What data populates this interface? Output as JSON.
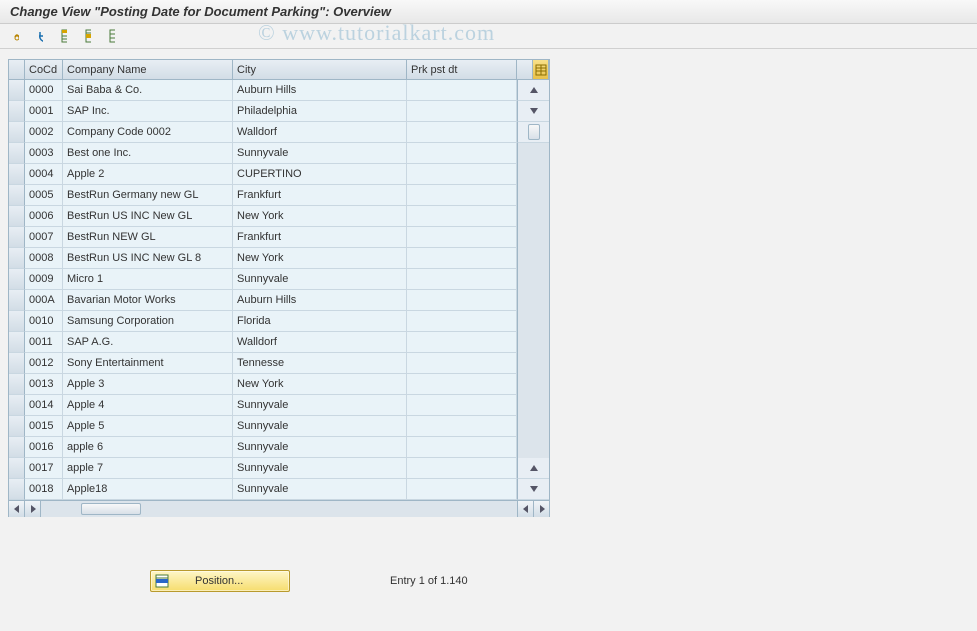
{
  "title": "Change View \"Posting Date for Document Parking\": Overview",
  "watermark": "© www.tutorialkart.com",
  "toolbar": {
    "glasses": "glasses-icon",
    "undo": "undo-icon",
    "save": "save-icon",
    "save_disk": "disk-save-icon",
    "delete": "delete-icon"
  },
  "columns": {
    "cocd": "CoCd",
    "company": "Company Name",
    "city": "City",
    "prk": "Prk pst dt"
  },
  "rows": [
    {
      "cocd": "0000",
      "company": "Sai Baba & Co.",
      "city": "Auburn Hills",
      "prk": ""
    },
    {
      "cocd": "0001",
      "company": "SAP Inc.",
      "city": "Philadelphia",
      "prk": ""
    },
    {
      "cocd": "0002",
      "company": "Company Code 0002",
      "city": "Walldorf",
      "prk": ""
    },
    {
      "cocd": "0003",
      "company": "Best one Inc.",
      "city": "Sunnyvale",
      "prk": ""
    },
    {
      "cocd": "0004",
      "company": "Apple 2",
      "city": "CUPERTINO",
      "prk": ""
    },
    {
      "cocd": "0005",
      "company": "BestRun Germany new GL",
      "city": "Frankfurt",
      "prk": ""
    },
    {
      "cocd": "0006",
      "company": "BestRun US INC New GL",
      "city": "New York",
      "prk": ""
    },
    {
      "cocd": "0007",
      "company": "BestRun NEW GL",
      "city": "Frankfurt",
      "prk": ""
    },
    {
      "cocd": "0008",
      "company": "BestRun US INC New GL 8",
      "city": "New York",
      "prk": ""
    },
    {
      "cocd": "0009",
      "company": "Micro 1",
      "city": "Sunnyvale",
      "prk": ""
    },
    {
      "cocd": "000A",
      "company": "Bavarian Motor Works",
      "city": "Auburn Hills",
      "prk": ""
    },
    {
      "cocd": "0010",
      "company": "Samsung Corporation",
      "city": "Florida",
      "prk": ""
    },
    {
      "cocd": "0011",
      "company": "SAP A.G.",
      "city": "Walldorf",
      "prk": ""
    },
    {
      "cocd": "0012",
      "company": "Sony Entertainment",
      "city": "Tennesse",
      "prk": ""
    },
    {
      "cocd": "0013",
      "company": "Apple 3",
      "city": "New York",
      "prk": ""
    },
    {
      "cocd": "0014",
      "company": "Apple 4",
      "city": "Sunnyvale",
      "prk": ""
    },
    {
      "cocd": "0015",
      "company": "Apple 5",
      "city": "Sunnyvale",
      "prk": ""
    },
    {
      "cocd": "0016",
      "company": "apple 6",
      "city": "Sunnyvale",
      "prk": ""
    },
    {
      "cocd": "0017",
      "company": "apple 7",
      "city": "Sunnyvale",
      "prk": ""
    },
    {
      "cocd": "0018",
      "company": "Apple18",
      "city": "Sunnyvale",
      "prk": ""
    }
  ],
  "footer": {
    "position_label": "Position...",
    "entry_info": "Entry 1 of 1.140"
  }
}
